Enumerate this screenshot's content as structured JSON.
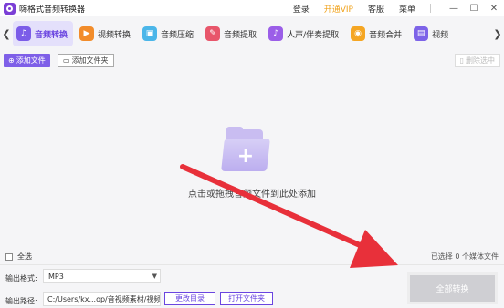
{
  "app": {
    "title": "嗨格式音频转换器"
  },
  "titlebar": {
    "links": [
      {
        "label": "登录"
      },
      {
        "label": "开通VIP",
        "accent": "#f0a21b"
      },
      {
        "label": "客服"
      },
      {
        "label": "菜单"
      }
    ]
  },
  "tabs": [
    {
      "label": "音频转换",
      "icon": "music-note-icon",
      "color": "#7b5ce8",
      "active": true
    },
    {
      "label": "视频转换",
      "icon": "video-icon",
      "color": "#f28c2a"
    },
    {
      "label": "音频压缩",
      "icon": "compress-icon",
      "color": "#4bb6e9"
    },
    {
      "label": "音频提取",
      "icon": "extract-icon",
      "color": "#e8566b"
    },
    {
      "label": "人声/伴奏提取",
      "icon": "voice-icon",
      "color": "#9b5ee8"
    },
    {
      "label": "音频合并",
      "icon": "merge-icon",
      "color": "#f5a623"
    },
    {
      "label": "视频",
      "icon": "video-extra-icon",
      "color": "#7d63e8"
    }
  ],
  "toolbar": {
    "add_file": "添加文件",
    "add_folder": "添加文件夹",
    "delete_selected": "删除选中"
  },
  "drop": {
    "hint": "点击或拖拽音频文件到此处添加"
  },
  "bottom": {
    "select_all": "全选",
    "selected_info": "已选择 0 个媒体文件",
    "format_label": "输出格式:",
    "format_value": "MP3",
    "path_label": "输出路径:",
    "path_value": "C:/Users/kx...op/音视频素材/视频",
    "change_dir": "更改目录",
    "open_folder": "打开文件夹",
    "convert_all": "全部转换"
  },
  "colors": {
    "accent": "#6a45e0",
    "annotation_arrow": "#e8303a"
  }
}
